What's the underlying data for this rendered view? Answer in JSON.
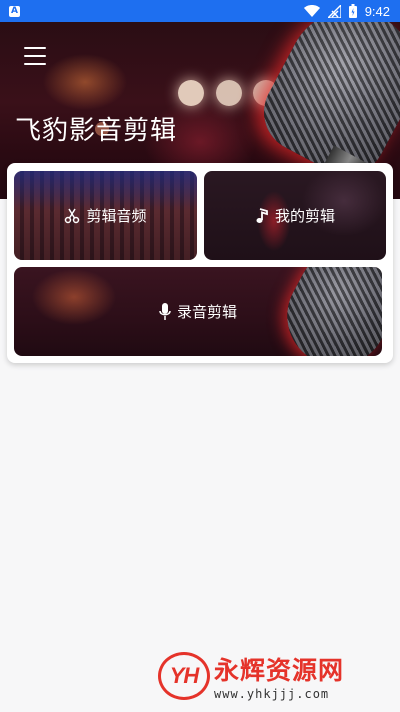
{
  "status_bar": {
    "notification_icon": "A",
    "time": "9:42",
    "icons": [
      "wifi-icon",
      "signal-icon",
      "battery-icon"
    ]
  },
  "header": {
    "menu_icon": "menu-icon",
    "title": "飞豹影音剪辑"
  },
  "tiles": {
    "cut_audio": {
      "icon": "scissors-icon",
      "label": "剪辑音频"
    },
    "my_edits": {
      "icon": "music-note-icon",
      "label": "我的剪辑"
    },
    "record_edit": {
      "icon": "microphone-icon",
      "label": "录音剪辑"
    }
  },
  "watermark": {
    "logo": "YH",
    "name": "永辉资源网",
    "url": "www.yhkjjj.com"
  },
  "colors": {
    "status_bar": "#1e6ff0",
    "watermark_red": "#e5332a"
  }
}
